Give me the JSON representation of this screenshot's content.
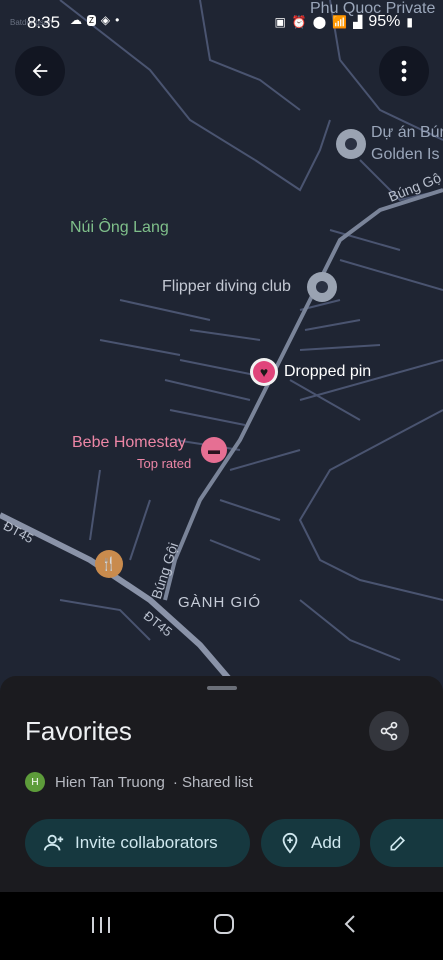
{
  "status": {
    "time": "8:35",
    "battery": "95%"
  },
  "watermark": "Batdongsan",
  "map": {
    "labels": {
      "place_top_line1": "Phu Quoc Private",
      "place_right_line1": "Dự án Bún",
      "place_right_line2": "Golden Is",
      "mountain": "Núi Ông Lang",
      "flipper": "Flipper diving club",
      "dropped_pin": "Dropped pin",
      "homestay": "Bebe Homestay",
      "homestay_sub": "Top rated",
      "ganh_gio": "GÀNH GIÓ",
      "road_bung_goi": "Búng Gội",
      "road_bung_go_top": "Búng Gộ",
      "road_dt45_a": "ĐT45",
      "road_dt45_b": "ĐT45"
    }
  },
  "sheet": {
    "title": "Favorites",
    "owner_initial": "H",
    "owner_name": "Hien Tan Truong",
    "owner_suffix": "· Shared list",
    "buttons": {
      "invite": "Invite collaborators",
      "add": "Add"
    }
  }
}
